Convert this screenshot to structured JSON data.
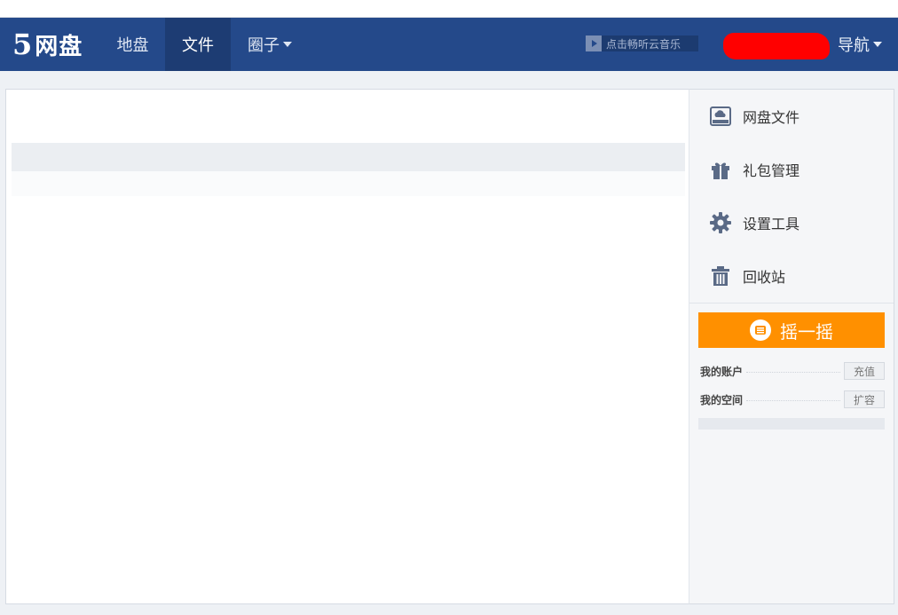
{
  "header": {
    "logo_num": "5",
    "logo_text": "网盘",
    "nav": [
      {
        "label": "地盘"
      },
      {
        "label": "文件"
      },
      {
        "label": "圈子"
      }
    ],
    "music_label": "点击畅听云音乐",
    "guide_label": "导航"
  },
  "sidebar": {
    "items": [
      {
        "label": "网盘文件",
        "icon": "cloud-drive-icon"
      },
      {
        "label": "礼包管理",
        "icon": "gift-icon"
      },
      {
        "label": "设置工具",
        "icon": "gear-icon"
      },
      {
        "label": "回收站",
        "icon": "trash-icon"
      }
    ],
    "shake_label": "摇一摇",
    "account_label": "我的账户",
    "recharge_label": "充值",
    "space_label": "我的空间",
    "expand_label": "扩容",
    "space_used_fraction": 0
  },
  "colors": {
    "header_bg": "#24498a",
    "accent_orange": "#ff9000",
    "icon_color": "#5a6a86"
  }
}
